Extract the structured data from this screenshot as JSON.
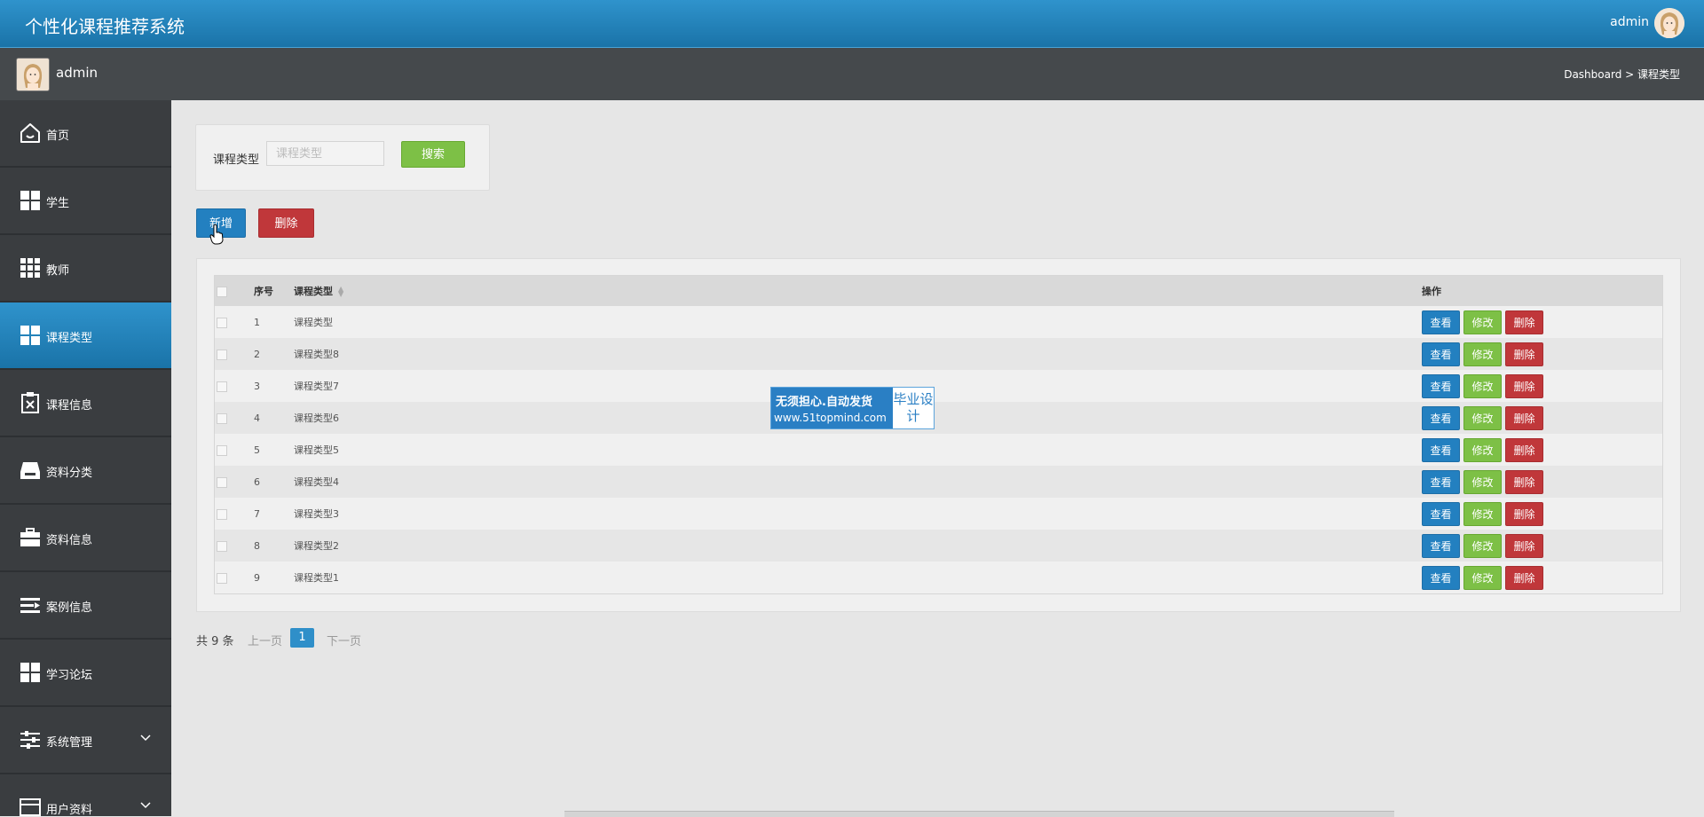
{
  "header": {
    "title": "个性化课程推荐系统",
    "user": "admin"
  },
  "subheader": {
    "user": "admin",
    "breadcrumb": "Dashboard > 课程类型"
  },
  "sidebar": {
    "items": [
      {
        "label": "首页",
        "icon": "home-icon"
      },
      {
        "label": "学生",
        "icon": "grid-icon"
      },
      {
        "label": "教师",
        "icon": "grid9-icon"
      },
      {
        "label": "课程类型",
        "icon": "grid-icon",
        "active": true
      },
      {
        "label": "课程信息",
        "icon": "clipboard-icon"
      },
      {
        "label": "资料分类",
        "icon": "inbox-icon"
      },
      {
        "label": "资料信息",
        "icon": "briefcase-icon"
      },
      {
        "label": "案例信息",
        "icon": "list-icon"
      },
      {
        "label": "学习论坛",
        "icon": "grid-icon"
      },
      {
        "label": "系统管理",
        "icon": "sliders-icon",
        "expandable": true
      },
      {
        "label": "用户资料",
        "icon": "card-icon",
        "expandable": true
      }
    ]
  },
  "search": {
    "label": "课程类型",
    "placeholder": "课程类型",
    "value": "",
    "button": "搜索"
  },
  "toolbar": {
    "add": "新增",
    "delete": "删除"
  },
  "table": {
    "columns": [
      "序号",
      "课程类型",
      "操作"
    ],
    "rows": [
      {
        "no": "1",
        "type": "课程类型"
      },
      {
        "no": "2",
        "type": "课程类型8"
      },
      {
        "no": "3",
        "type": "课程类型7"
      },
      {
        "no": "4",
        "type": "课程类型6"
      },
      {
        "no": "5",
        "type": "课程类型5"
      },
      {
        "no": "6",
        "type": "课程类型4"
      },
      {
        "no": "7",
        "type": "课程类型3"
      },
      {
        "no": "8",
        "type": "课程类型2"
      },
      {
        "no": "9",
        "type": "课程类型1"
      }
    ],
    "actions": {
      "view": "查看",
      "edit": "修改",
      "delete": "删除"
    }
  },
  "pager": {
    "total": "共 9 条",
    "prev": "上一页",
    "current": "1",
    "next": "下一页"
  },
  "watermark": {
    "line1": "无须担心.自动发货",
    "line2": "www.51topmind.com",
    "side": "毕业设计"
  },
  "colors": {
    "accent": "#2380c0",
    "success": "#7dc046",
    "danger": "#c0373a",
    "sidebar": "#3a3d40"
  }
}
